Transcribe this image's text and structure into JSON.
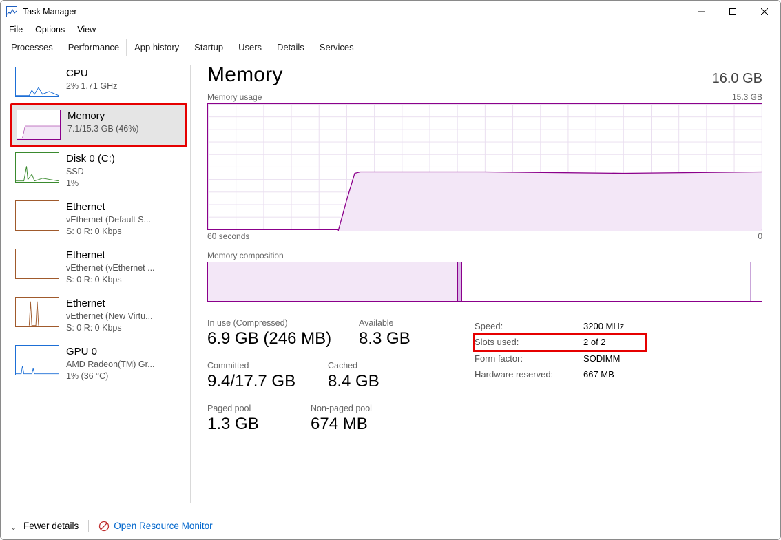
{
  "window": {
    "title": "Task Manager"
  },
  "menu": {
    "file": "File",
    "options": "Options",
    "view": "View"
  },
  "tabs": {
    "processes": "Processes",
    "performance": "Performance",
    "app_history": "App history",
    "startup": "Startup",
    "users": "Users",
    "details": "Details",
    "services": "Services"
  },
  "sidebar": {
    "cpu": {
      "title": "CPU",
      "sub": "2%  1.71 GHz"
    },
    "memory": {
      "title": "Memory",
      "sub": "7.1/15.3 GB (46%)"
    },
    "disk0": {
      "title": "Disk 0 (C:)",
      "sub1": "SSD",
      "sub2": "1%"
    },
    "eth1": {
      "title": "Ethernet",
      "sub1": "vEthernet (Default S...",
      "sub2": "S: 0  R: 0 Kbps"
    },
    "eth2": {
      "title": "Ethernet",
      "sub1": "vEthernet (vEthernet ...",
      "sub2": "S: 0  R: 0 Kbps"
    },
    "eth3": {
      "title": "Ethernet",
      "sub1": "vEthernet (New Virtu...",
      "sub2": "S: 0  R: 0 Kbps"
    },
    "gpu0": {
      "title": "GPU 0",
      "sub1": "AMD Radeon(TM) Gr...",
      "sub2": "1%  (36 °C)"
    }
  },
  "main": {
    "title": "Memory",
    "total": "16.0 GB",
    "usage_label": "Memory usage",
    "usage_max": "15.3 GB",
    "axis_left": "60 seconds",
    "axis_right": "0",
    "comp_label": "Memory composition",
    "stats": {
      "in_use_label": "In use (Compressed)",
      "in_use_value": "6.9 GB (246 MB)",
      "available_label": "Available",
      "available_value": "8.3 GB",
      "committed_label": "Committed",
      "committed_value": "9.4/17.7 GB",
      "cached_label": "Cached",
      "cached_value": "8.4 GB",
      "paged_label": "Paged pool",
      "paged_value": "1.3 GB",
      "nonpaged_label": "Non-paged pool",
      "nonpaged_value": "674 MB"
    },
    "kv": {
      "speed_k": "Speed:",
      "speed_v": "3200 MHz",
      "slots_k": "Slots used:",
      "slots_v": "2 of 2",
      "form_k": "Form factor:",
      "form_v": "SODIMM",
      "hw_k": "Hardware reserved:",
      "hw_v": "667 MB"
    }
  },
  "footer": {
    "fewer": "Fewer details",
    "open_rm": "Open Resource Monitor"
  },
  "chart_data": {
    "type": "area",
    "title": "Memory usage",
    "ylabel": "GB",
    "ylim": [
      0,
      15.3
    ],
    "xlabel": "seconds ago",
    "xlim": [
      60,
      0
    ],
    "series": [
      {
        "name": "In use (GB)",
        "x": [
          60,
          46,
          45,
          44,
          43,
          30,
          15,
          0
        ],
        "values": [
          0,
          0,
          3.5,
          6.5,
          7.1,
          7.1,
          7.0,
          7.1
        ]
      }
    ],
    "composition": {
      "in_use_gb": 6.9,
      "modified_gb": 0.1,
      "standby_gb": 8.0,
      "free_gb": 0.3,
      "total_gb": 15.3
    }
  }
}
